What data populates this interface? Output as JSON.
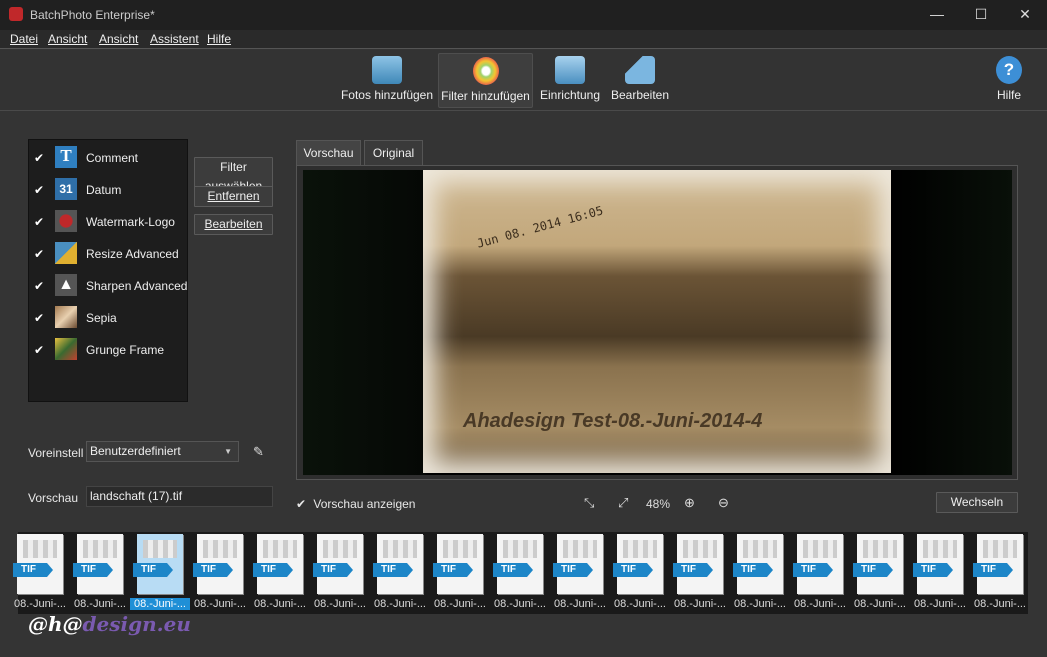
{
  "window": {
    "title": "BatchPhoto Enterprise*",
    "minimize": "—",
    "maximize": "☐",
    "close": "✕"
  },
  "menu": [
    "Datei",
    "Ansicht",
    "Ansicht",
    "Assistent",
    "Hilfe"
  ],
  "toolbar": [
    {
      "label": "Fotos hinzufügen",
      "icon": "add-photos-icon",
      "step": "1"
    },
    {
      "label": "Filter hinzufügen",
      "icon": "add-filter-icon",
      "step": "2",
      "active": true
    },
    {
      "label": "Einrichtung",
      "icon": "setup-icon",
      "step": "3"
    },
    {
      "label": "Bearbeiten",
      "icon": "process-icon"
    }
  ],
  "help": {
    "label": "Hilfe",
    "icon": "?"
  },
  "filters": [
    {
      "label": "Comment",
      "checked": true,
      "icon": "T"
    },
    {
      "label": "Datum",
      "checked": true,
      "icon": "31"
    },
    {
      "label": "Watermark-Logo",
      "checked": true,
      "icon": "logo"
    },
    {
      "label": "Resize Advanced",
      "checked": true,
      "icon": "resize"
    },
    {
      "label": "Sharpen Advanced",
      "checked": true,
      "icon": "sharpen"
    },
    {
      "label": "Sepia",
      "checked": true,
      "icon": "sepia"
    },
    {
      "label": "Grunge Frame",
      "checked": true,
      "icon": "frame"
    }
  ],
  "filter_buttons": {
    "select": "Filter auswählen",
    "remove": "Entfernen",
    "edit": "Bearbeiten"
  },
  "preset": {
    "label": "Voreinstell",
    "value": "Benutzerdefiniert"
  },
  "preview_file": {
    "label": "Vorschau",
    "value": "landschaft (17).tif"
  },
  "tabs": [
    "Vorschau",
    "Original"
  ],
  "preview_overlay": {
    "date": "Jun 08. 2014 16:05",
    "watermark": "Ahadesign Test-08.-Juni-2014-4"
  },
  "show_preview": {
    "label": "Vorschau anzeigen",
    "checked": true
  },
  "zoom": {
    "level": "48%"
  },
  "switch_button": "Wechseln",
  "thumbs": {
    "type": "TIF",
    "labels": [
      "08.-Juni-...",
      "08.-Juni-...",
      "08.-Juni-...",
      "08.-Juni-...",
      "08.-Juni-...",
      "08.-Juni-...",
      "08.-Juni-...",
      "08.-Juni-...",
      "08.-Juni-...",
      "08.-Juni-...",
      "08.-Juni-...",
      "08.-Juni-...",
      "08.-Juni-...",
      "08.-Juni-...",
      "08.-Juni-...",
      "08.-Juni-...",
      "08.-Juni-..."
    ],
    "selected": 2
  },
  "watermark_logo": "@h@design.eu"
}
